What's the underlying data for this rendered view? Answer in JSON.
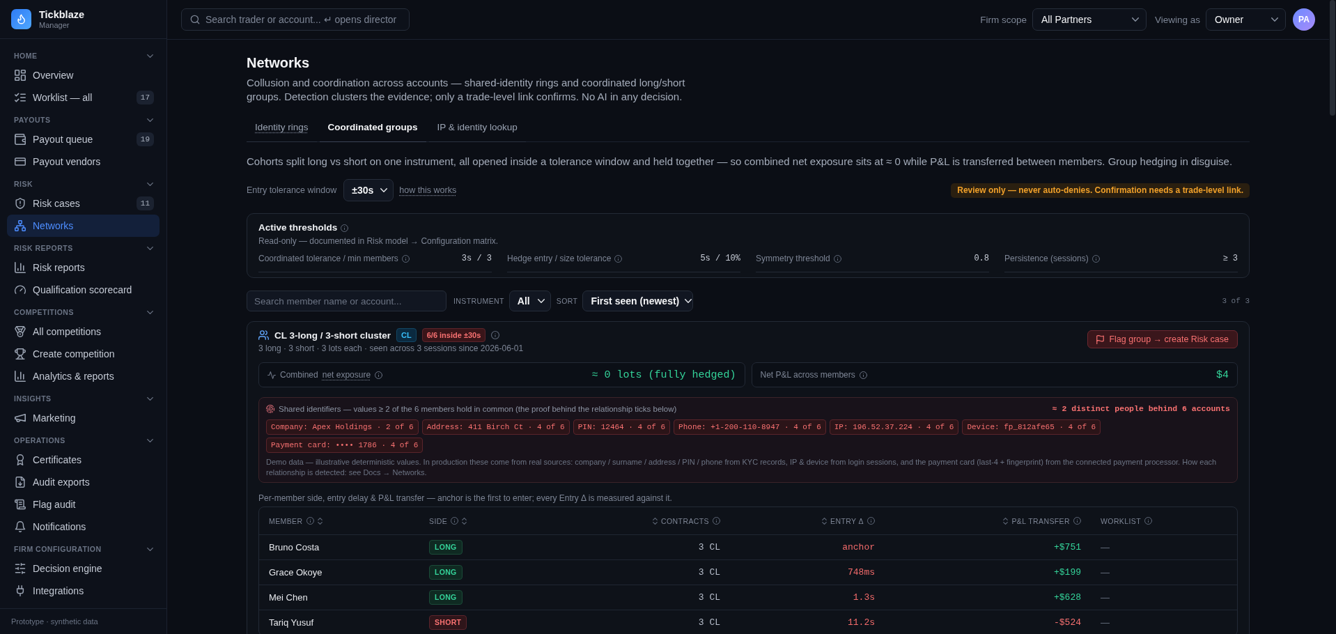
{
  "app": {
    "name": "Tickblaze",
    "subtitle": "Manager"
  },
  "sidebar": {
    "sections": [
      {
        "title": "HOME",
        "expanded": true,
        "items": [
          {
            "label": "Overview",
            "selected": false
          },
          {
            "label": "Worklist — all",
            "badge": "17",
            "selected": false
          }
        ]
      },
      {
        "title": "PAYOUTS",
        "expanded": true,
        "items": [
          {
            "label": "Payout queue",
            "badge": "19",
            "selected": false
          },
          {
            "label": "Payout vendors",
            "selected": false
          }
        ]
      },
      {
        "title": "RISK",
        "expanded": true,
        "items": [
          {
            "label": "Risk cases",
            "badge": "11",
            "selected": false
          },
          {
            "label": "Networks",
            "selected": true
          }
        ]
      },
      {
        "title": "RISK REPORTS",
        "expanded": true,
        "items": [
          {
            "label": "Risk reports",
            "selected": false
          },
          {
            "label": "Qualification scorecard",
            "selected": false
          }
        ]
      },
      {
        "title": "COMPETITIONS",
        "expanded": true,
        "items": [
          {
            "label": "All competitions",
            "selected": false
          },
          {
            "label": "Create competition",
            "selected": false
          },
          {
            "label": "Analytics & reports",
            "selected": false
          }
        ]
      },
      {
        "title": "INSIGHTS",
        "expanded": true,
        "items": [
          {
            "label": "Marketing",
            "selected": false
          }
        ]
      },
      {
        "title": "OPERATIONS",
        "expanded": true,
        "items": [
          {
            "label": "Certificates",
            "selected": false
          },
          {
            "label": "Audit exports",
            "selected": false
          },
          {
            "label": "Flag audit",
            "selected": false
          },
          {
            "label": "Notifications",
            "selected": false
          }
        ]
      },
      {
        "title": "FIRM CONFIGURATION",
        "expanded": true,
        "items": [
          {
            "label": "Decision engine",
            "selected": false
          },
          {
            "label": "Integrations",
            "selected": false
          }
        ]
      }
    ],
    "footer": "Prototype · synthetic data"
  },
  "topbar": {
    "search": {
      "placeholder": "Search trader or account... ↵ opens director"
    },
    "scope": {
      "label": "Firm scope",
      "value": "All Partners"
    },
    "viewing": {
      "label": "Viewing as",
      "value": "Owner"
    },
    "avatar": "PA"
  },
  "page": {
    "title": "Networks",
    "description": "Collusion and coordination across accounts — shared-identity rings and coordinated long/short groups. Detection clusters the evidence; only a trade-level link confirms. No AI in any decision.",
    "tabs": [
      {
        "label": "Identity rings",
        "hint": true,
        "selected": false
      },
      {
        "label": "Coordinated groups",
        "hint": false,
        "selected": true
      },
      {
        "label": "IP & identity lookup",
        "hint": false,
        "selected": false
      }
    ],
    "intro": "Cohorts split long vs short on one instrument, all opened inside a tolerance window and held together — so combined net exposure sits at ≈ 0 while P&L is transferred between members. Group hedging in disguise.",
    "tolerance": {
      "label": "Entry tolerance window",
      "value": "±30s",
      "link": "how this works"
    },
    "notice": "Review only — never auto-denies. Confirmation needs a trade-level link.",
    "thresholds": {
      "title": "Active thresholds",
      "subtitle": "Read-only — documented in Risk model → Configuration matrix.",
      "items": [
        {
          "label": "Coordinated tolerance / min members",
          "value": "3s / 3"
        },
        {
          "label": "Hedge entry / size tolerance",
          "value": "5s / 10%"
        },
        {
          "label": "Symmetry threshold",
          "value": "0.8"
        },
        {
          "label": "Persistence (sessions)",
          "value": "≥ 3"
        }
      ]
    },
    "filters": {
      "search": {
        "placeholder": "Search member name or account..."
      },
      "instrument": {
        "label": "INSTRUMENT",
        "value": "All"
      },
      "sort": {
        "label": "SORT",
        "value": "First seen (newest)"
      },
      "count": "3 of 3"
    },
    "groups": [
      {
        "title": "CL 3-long / 3-short cluster",
        "instrument": "CL",
        "window": "6/6 inside ±30s",
        "summary": "3 long · 3 short · 3 lots each · seen across 3 sessions since 2026-06-01",
        "action": "Flag group → create Risk case",
        "exposure": {
          "label": "Combined",
          "term": "net exposure",
          "value": "≈ 0 lots (fully hedged)"
        },
        "net_pnl": {
          "label": "Net P&L across members",
          "value": "$4"
        },
        "shared": {
          "heading": "Shared identifiers — values ≥ 2 of the 6 members hold in common (the proof behind the relationship ticks below)",
          "verdict": "≈ 2 distinct people behind 6 accounts",
          "chips": [
            "Company: Apex Holdings · 2 of 6",
            "Address: 411 Birch Ct · 4 of 6",
            "PIN: 12464 · 4 of 6",
            "Phone: +1-200-110-8947 · 4 of 6",
            "IP: 196.52.37.224 · 4 of 6",
            "Device: fp_812afe65 · 4 of 6",
            "Payment card: •••• 1786 · 4 of 6"
          ],
          "note": "Demo data — illustrative deterministic values. In production these come from real sources: company / surname / address / PIN / phone from KYC records, IP & device from login sessions, and the payment card (last-4 + fingerprint) from the connected payment processor. How each relationship is detected: see Docs → Networks."
        },
        "caption": "Per-member side, entry delay & P&L transfer — anchor is the first to enter; every Entry Δ is measured against it.",
        "table": {
          "columns": [
            {
              "label": "MEMBER",
              "sortable": true
            },
            {
              "label": "SIDE",
              "sortable": true
            },
            {
              "label": "CONTRACTS",
              "sortable": true
            },
            {
              "label": "ENTRY Δ",
              "sortable": true
            },
            {
              "label": "P&L TRANSFER",
              "sortable": true
            },
            {
              "label": "WORKLIST",
              "sortable": false
            }
          ],
          "rows": [
            {
              "member": "Bruno Costa",
              "side": "LONG",
              "short": false,
              "contracts": "3 CL",
              "entry": "anchor",
              "pnl": "+$751",
              "loss": false,
              "worklist": "—"
            },
            {
              "member": "Grace Okoye",
              "side": "LONG",
              "short": false,
              "contracts": "3 CL",
              "entry": "748ms",
              "pnl": "+$199",
              "loss": false,
              "worklist": "—"
            },
            {
              "member": "Mei Chen",
              "side": "LONG",
              "short": false,
              "contracts": "3 CL",
              "entry": "1.3s",
              "pnl": "+$628",
              "loss": false,
              "worklist": "—"
            },
            {
              "member": "Tariq Yusuf",
              "side": "SHORT",
              "short": true,
              "contracts": "3 CL",
              "entry": "11.2s",
              "pnl": "-$524",
              "loss": true,
              "worklist": "—"
            }
          ]
        }
      }
    ]
  }
}
